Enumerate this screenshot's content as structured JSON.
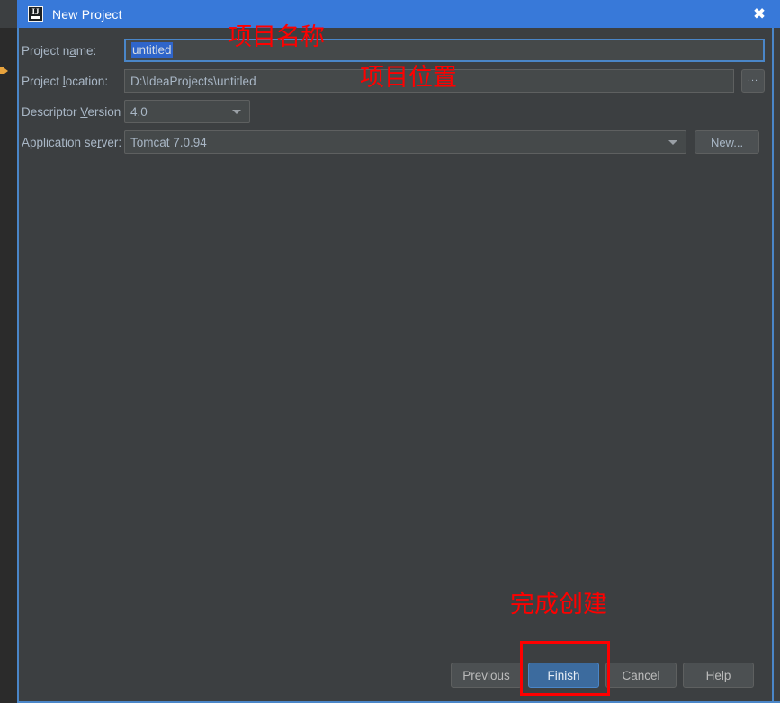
{
  "window": {
    "title": "New Project",
    "app_icon": "intellij-idea-icon",
    "close_icon": "close-icon",
    "titlebar_color": "#3879d9",
    "frame_border_color": "#4a86c8",
    "background_color": "#3c3f41"
  },
  "form": {
    "project_name": {
      "label_prefix": "Project n",
      "label_mnemonic": "a",
      "label_suffix": "me:",
      "value": "untitled",
      "selected": true,
      "focused": true
    },
    "project_location": {
      "label_prefix": "Project ",
      "label_mnemonic": "l",
      "label_suffix": "ocation:",
      "value": "D:\\IdeaProjects\\untitled",
      "browse_label": "...",
      "browse_icon": "ellipsis-icon"
    },
    "descriptor_version": {
      "label_prefix": "Descriptor ",
      "label_mnemonic": "V",
      "label_suffix": "ersion",
      "value": "4.0",
      "caret_icon": "chevron-down-icon"
    },
    "application_server": {
      "label_prefix": "Application se",
      "label_mnemonic": "r",
      "label_suffix": "ver:",
      "value": "Tomcat 7.0.94",
      "caret_icon": "chevron-down-icon",
      "new_button_label": "New..."
    }
  },
  "buttons": {
    "previous": {
      "prefix": "",
      "mnemonic": "P",
      "suffix": "revious"
    },
    "finish": {
      "prefix": "",
      "mnemonic": "F",
      "suffix": "inish",
      "primary": true,
      "primary_color": "#3c6b9e"
    },
    "cancel": {
      "prefix": "Cancel",
      "mnemonic": "",
      "suffix": ""
    },
    "help": {
      "prefix": "Help",
      "mnemonic": "",
      "suffix": ""
    }
  },
  "annotations": {
    "color": "#ff0000",
    "items": [
      {
        "text": "项目名称"
      },
      {
        "text": "项目位置"
      },
      {
        "text": "完成创建"
      }
    ]
  }
}
